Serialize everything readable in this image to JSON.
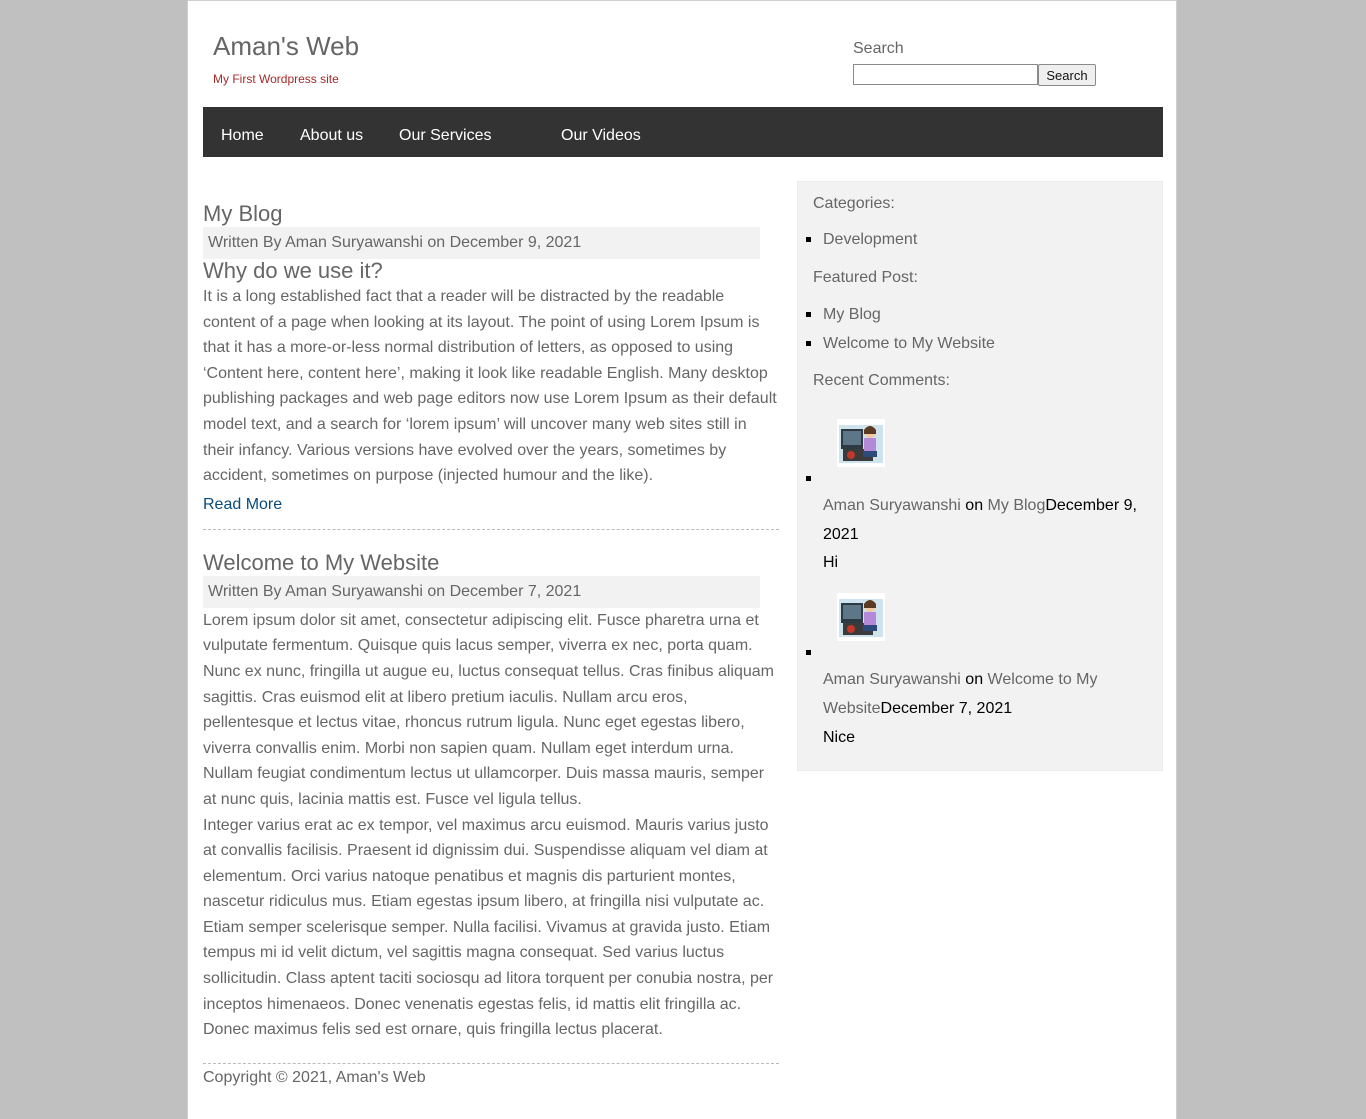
{
  "site": {
    "title": "Aman's Web",
    "tagline": "My First Wordpress site"
  },
  "search": {
    "label": "Search",
    "input_value": "",
    "button_label": "Search"
  },
  "nav": {
    "items": [
      {
        "label": "Home"
      },
      {
        "label": "About us"
      },
      {
        "label": "Our Services"
      },
      {
        "label": "Our Videos"
      }
    ]
  },
  "posts": [
    {
      "title": "My Blog",
      "meta": "Written By Aman Suryawanshi on December 9, 2021",
      "subheading": "Why do we use it?",
      "paragraphs": [
        "It is a long established fact that a reader will be distracted by the readable content of a page when looking at its layout. The point of using Lorem Ipsum is that it has a more-or-less normal distribution of letters, as opposed to using ‘Content here, content here’, making it look like readable English. Many desktop publishing packages and web page editors now use Lorem Ipsum as their default model text, and a search for ‘lorem ipsum’ will uncover many web sites still in their infancy. Various versions have evolved over the years, sometimes by accident, sometimes on purpose (injected humour and the like)."
      ],
      "read_more": "Read More"
    },
    {
      "title": "Welcome to My Website",
      "meta": "Written By Aman Suryawanshi on December 7, 2021",
      "paragraphs": [
        "Lorem ipsum dolor sit amet, consectetur adipiscing elit. Fusce pharetra urna et vulputate fermentum. Quisque quis lacus semper, viverra ex nec, porta quam. Nunc ex nunc, fringilla ut augue eu, luctus consequat tellus. Cras finibus aliquam sagittis. Cras euismod elit at libero pretium iaculis. Nullam arcu eros, pellentesque et lectus vitae, rhoncus rutrum ligula. Nunc eget egestas libero, viverra convallis enim. Morbi non sapien quam. Nullam eget interdum urna. Nullam feugiat condimentum lectus ut ullamcorper. Duis massa mauris, semper at nunc quis, lacinia mattis est. Fusce vel ligula tellus.",
        "Integer varius erat ac ex tempor, vel maximus arcu euismod. Mauris varius justo at convallis facilisis. Praesent id dignissim dui. Suspendisse aliquam vel diam at elementum. Orci varius natoque penatibus et magnis dis parturient montes, nascetur ridiculus mus. Etiam egestas ipsum libero, at fringilla nisi vulputate ac. Etiam semper scelerisque semper. Nulla facilisi. Vivamus at gravida justo. Etiam tempus mi id velit dictum, vel sagittis magna consequat. Sed varius luctus sollicitudin. Class aptent taciti sociosqu ad litora torquent per conubia nostra, per inceptos himenaeos. Donec venenatis egestas felis, id mattis elit fringilla ac. Donec maximus felis sed est ornare, quis fringilla lectus placerat."
      ]
    }
  ],
  "footer": {
    "copyright": "Copyright © 2021, Aman's Web"
  },
  "sidebar": {
    "categories_heading": "Categories:",
    "categories": [
      "Development"
    ],
    "featured_heading": "Featured Post:",
    "featured": [
      "My Blog",
      "Welcome to My Website"
    ],
    "comments_heading": "Recent Comments:",
    "comments": [
      {
        "author": "Aman Suryawanshi",
        "on_word": "on",
        "post_line1": "My Blog",
        "post_line2": "",
        "date_line1": "December 9,",
        "date_line2": "2021",
        "text": "Hi"
      },
      {
        "author": "Aman Suryawanshi",
        "on_word": "on",
        "post_line1": "Welcome to My",
        "post_line2": "Website",
        "date_line1": "",
        "date_line2": "December 7, 2021",
        "text": "Nice"
      }
    ]
  },
  "icons": {
    "avatar": "user-avatar-icon"
  },
  "colors": {
    "background": "#c0c0c0",
    "nav_bar": "#333333",
    "tagline": "#a52a2a",
    "link": "#0b4a7a",
    "text": "#666666",
    "panel": "#f2f2f2"
  }
}
